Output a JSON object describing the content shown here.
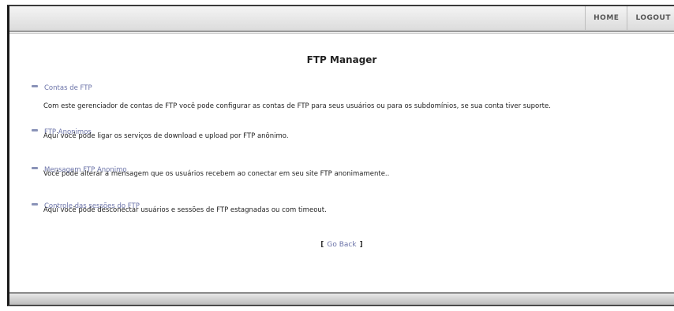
{
  "nav": {
    "home_label": "HOME",
    "logout_label": "LOGOUT"
  },
  "page": {
    "title": "FTP Manager"
  },
  "items": [
    {
      "link": "Contas de FTP",
      "description": "Com este gerenciador de contas de FTP você pode configurar as contas de FTP para seus usuários ou para os subdomínios, se sua conta tiver suporte."
    },
    {
      "link": "FTP Anonimos",
      "description": "Aqui você pode ligar os serviços de download e upload por FTP anônimo."
    },
    {
      "link": "Mensagem FTP Anonimo",
      "description": "Você pode alterar a mensagem que os usuários recebem ao conectar em seu site FTP anonimamente.."
    },
    {
      "link": "Controle das sessões do FTP",
      "description": "Aqui você pode desconectar usuários e sessões de FTP estagnadas ou com timeout."
    }
  ],
  "go_back": {
    "bracket_open": "[",
    "label": "Go Back",
    "bracket_close": "]"
  },
  "colors": {
    "link": "#6b73a8",
    "text": "#222222",
    "topbar": "#e6e6e6"
  }
}
